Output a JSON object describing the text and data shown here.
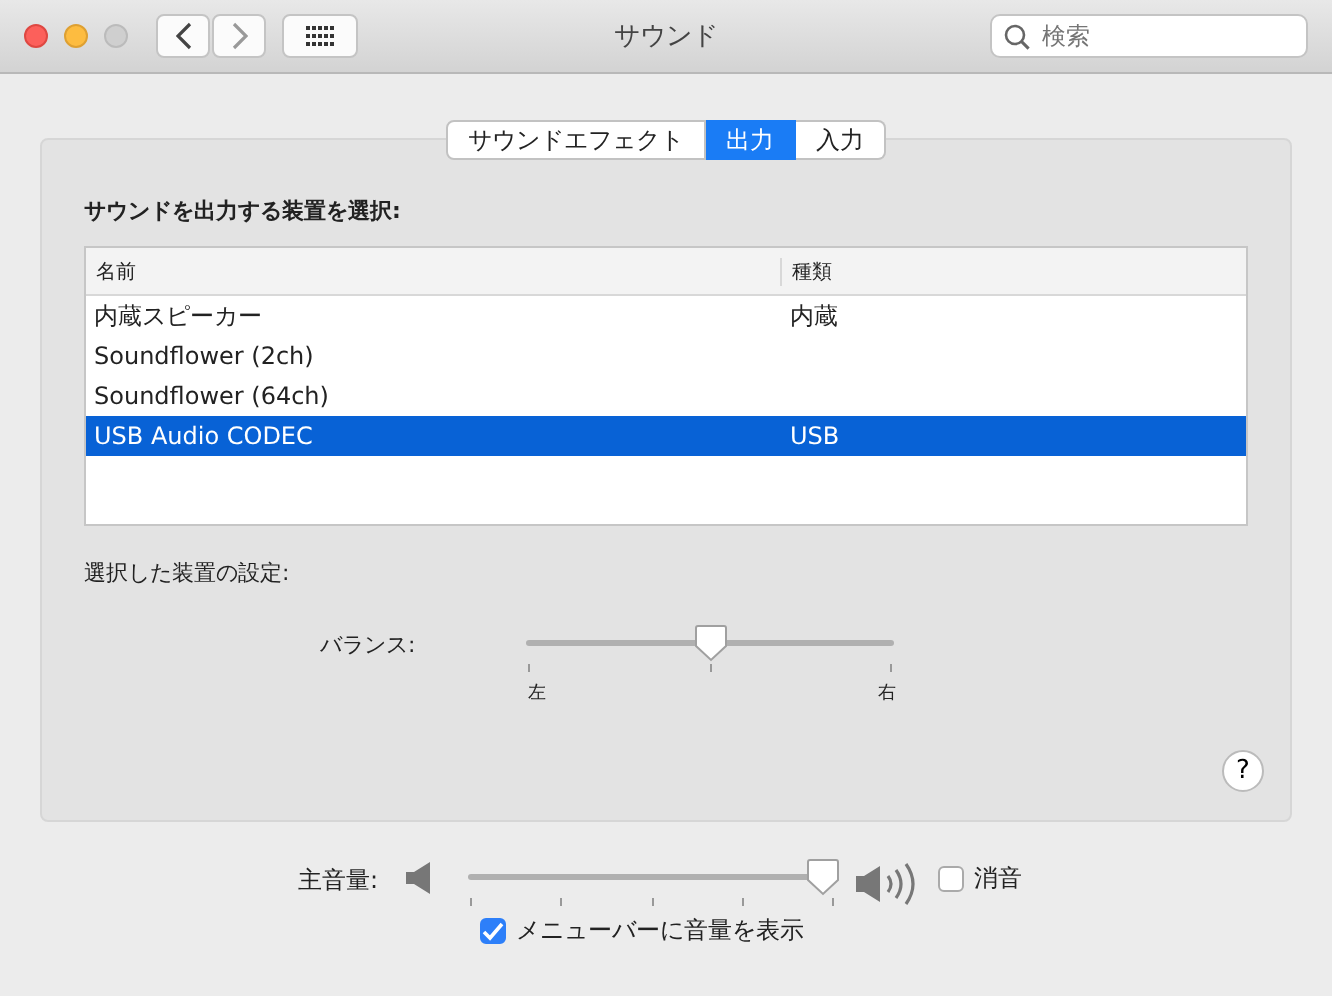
{
  "window": {
    "title": "サウンド",
    "search": {
      "placeholder": "検索"
    }
  },
  "tabs": [
    {
      "label": "サウンドエフェクト",
      "selected": false
    },
    {
      "label": "出力",
      "selected": true
    },
    {
      "label": "入力",
      "selected": false
    }
  ],
  "device_heading": "サウンドを出力する装置を選択:",
  "table": {
    "columns": [
      "名前",
      "種類"
    ],
    "rows": [
      {
        "cells": [
          "内蔵スピーカー",
          "内蔵"
        ],
        "selected": false
      },
      {
        "cells": [
          "Soundflower (2ch)",
          ""
        ],
        "selected": false
      },
      {
        "cells": [
          "Soundflower (64ch)",
          ""
        ],
        "selected": false
      },
      {
        "cells": [
          "USB Audio CODEC",
          "USB"
        ],
        "selected": true
      }
    ]
  },
  "settings_heading": "選択した装置の設定:",
  "balance": {
    "label": "バランス:",
    "level": 0.5,
    "left_label": "左",
    "right_label": "右"
  },
  "help": "?",
  "volume": {
    "label": "主音量:",
    "level": 0.96,
    "mute": {
      "label": "消音",
      "checked": false
    }
  },
  "menubar_option": {
    "label": "メニューバーに音量を表示",
    "checked": true
  }
}
